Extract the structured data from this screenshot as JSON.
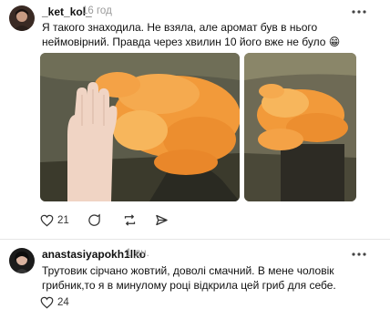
{
  "post": {
    "username": "_ket_kol_",
    "time": "16 год",
    "text": "Я такого знаходила. Не взяла, але аромат був в нього неймовірний. Правда через хвилин 10 його вже не було 😁",
    "likes": "21",
    "more_icon": "more-options-icon"
  },
  "comment": {
    "username": "anastasiyapokh1lko",
    "time": "1 дн.",
    "text": "Трутовик сірчано жовтий, доволі смачний. В мене чоловік грибник,то я в минулому році відкрила цей гриб для себе.",
    "likes": "24"
  },
  "colors": {
    "accent_orange": "#f29a3a",
    "muted_text": "#9a9a9a",
    "divider": "#e6e6e6"
  }
}
